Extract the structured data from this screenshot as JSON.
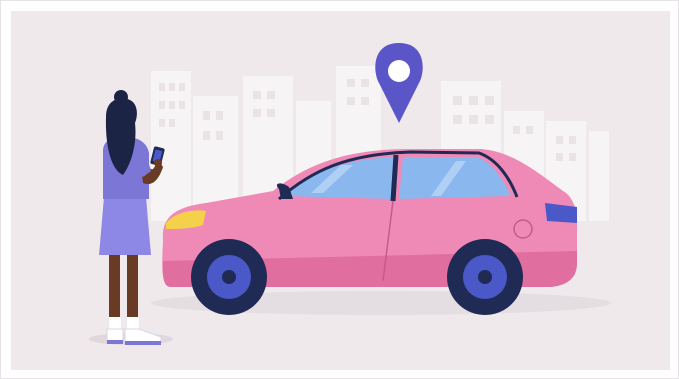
{
  "illustration": {
    "subject": "car-location-scene",
    "colors": {
      "background": "#efe9ec",
      "buildings": "#f7f4f6",
      "car_body": "#ef8ab7",
      "car_body_dark": "#e06e9f",
      "windows": "#8bb7ef",
      "tires": "#1f2a55",
      "rims": "#4b58c8",
      "pin": "#5b56c7",
      "headlight": "#f5d04b",
      "shirt": "#7c76d6",
      "skirt": "#8d88e6",
      "skin": "#6a3b24",
      "hair": "#1c2446"
    },
    "icons": [
      "map-pin-icon",
      "smartphone-icon"
    ]
  }
}
